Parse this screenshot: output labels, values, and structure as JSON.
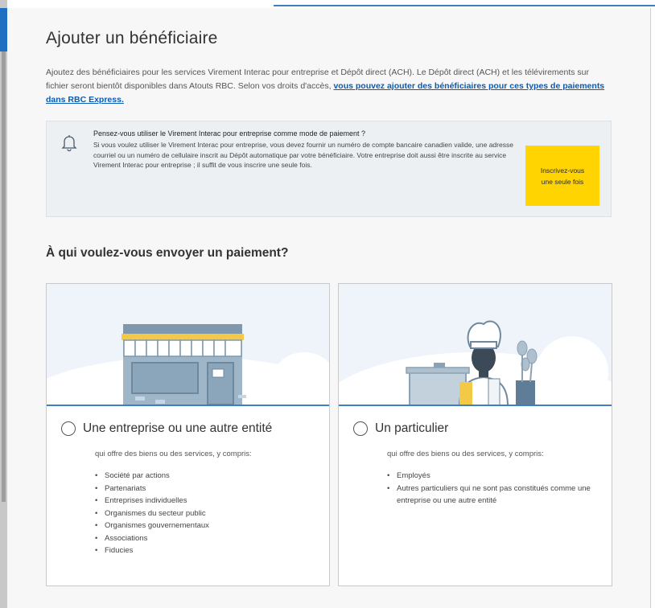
{
  "page": {
    "title": "Ajouter un bénéficiaire",
    "intro_text": "Ajoutez des bénéficiaires pour les services Virement Interac pour entreprise et Dépôt direct (ACH). Le Dépôt direct (ACH) et les télévirements sur fichier seront bientôt disponibles dans Atouts RBC. Selon vos droits d'accès, ",
    "intro_link": "vous pouvez ajouter des bénéficiaires pour ces types de paiements dans RBC Express."
  },
  "notice": {
    "icon": "bell-icon",
    "title": "Pensez-vous utiliser le Virement Interac pour entreprise comme mode de paiement ?",
    "body": "Si vous voulez utiliser le Virement Interac pour entreprise, vous devez fournir un numéro de compte bancaire canadien valide, une adresse courriel ou un numéro de cellulaire inscrit au Dépôt automatique par votre bénéficiaire. Votre entreprise doit aussi être inscrite au service Virement Interac pour entreprise ; il suffit de vous inscrire une seule fois.",
    "cta_label": "Inscrivez-vous une seule fois",
    "cta_color": "#ffd400"
  },
  "question": "À qui voulez-vous envoyer un paiement?",
  "options": [
    {
      "title": "Une entreprise ou une autre entité",
      "subtitle": "qui offre des biens ou des services, y compris:",
      "items": [
        "Société par actions",
        "Partenariats",
        "Entreprises individuelles",
        "Organismes du secteur public",
        "Organismes gouvernementaux",
        "Associations",
        "Fiducies"
      ]
    },
    {
      "title": "Un particulier",
      "subtitle": "qui offre des biens ou des services, y compris:",
      "items": [
        "Employés",
        "Autres particuliers qui ne sont pas constitués comme une entreprise ou une autre entité"
      ]
    }
  ],
  "colors": {
    "accent_blue": "#1f6fc2",
    "link_blue": "#0a5bb5",
    "cta_yellow": "#ffd400"
  }
}
